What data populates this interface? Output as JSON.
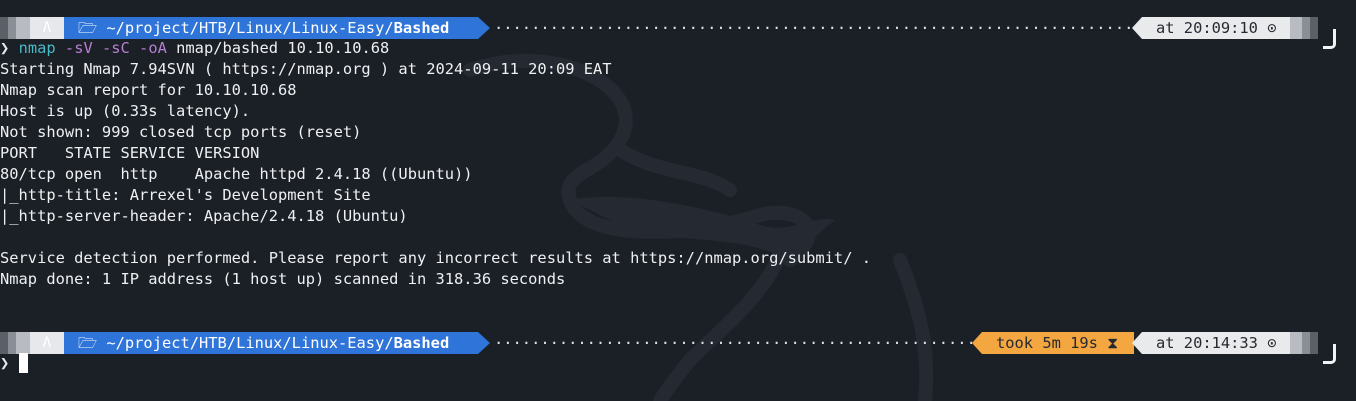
{
  "prompt1": {
    "os_icon": "Λ",
    "folder_icon": "folder-icon",
    "path": "~/project/HTB/Linux/Linux-Easy/",
    "path_bold": "Bashed",
    "time": "at 20:09:10",
    "clock_icon": "clock-icon"
  },
  "command": {
    "prompt_char": "❯",
    "program": "nmap",
    "flags": "-sV -sC -oA",
    "args": "nmap/bashed 10.10.10.68"
  },
  "output": [
    "Starting Nmap 7.94SVN ( https://nmap.org ) at 2024-09-11 20:09 EAT",
    "Nmap scan report for 10.10.10.68",
    "Host is up (0.33s latency).",
    "Not shown: 999 closed tcp ports (reset)",
    "PORT   STATE SERVICE VERSION",
    "80/tcp open  http    Apache httpd 2.4.18 ((Ubuntu))",
    "|_http-title: Arrexel's Development Site",
    "|_http-server-header: Apache/2.4.18 (Ubuntu)",
    "",
    "Service detection performed. Please report any incorrect results at https://nmap.org/submit/ .",
    "Nmap done: 1 IP address (1 host up) scanned in 318.36 seconds"
  ],
  "prompt2": {
    "os_icon": "Λ",
    "path": "~/project/HTB/Linux/Linux-Easy/",
    "path_bold": "Bashed",
    "duration": "took 5m 19s",
    "hourglass_icon": "hourglass-icon",
    "time": "at 20:14:33",
    "clock_icon": "clock-icon"
  },
  "input": {
    "prompt_char": "❯",
    "value": ""
  },
  "colors": {
    "background": "#1b1f26",
    "path_segment": "#2f74d8",
    "took_segment": "#f4a640",
    "time_segment": "#e9eaec",
    "nmap_command": "#48b9c7",
    "flag": "#b77fd0"
  }
}
